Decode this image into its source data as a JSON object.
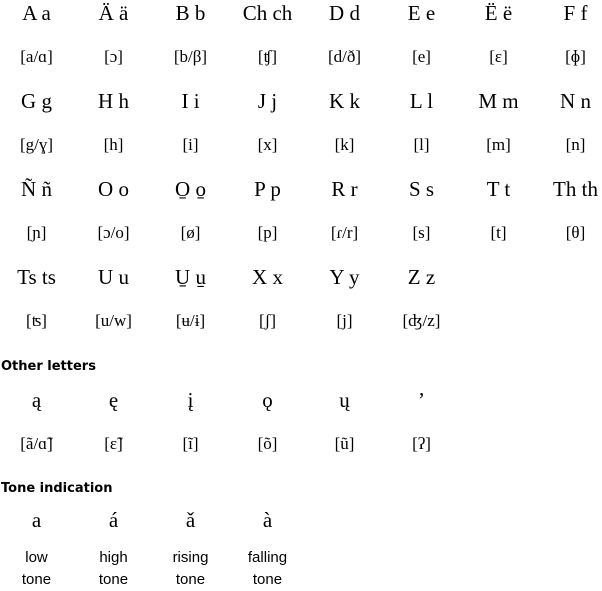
{
  "alphabet": {
    "rows": [
      {
        "letters": [
          "A a",
          "Ä ä",
          "B b",
          "Ch ch",
          "D d",
          "E e",
          "Ë ë",
          "F f"
        ],
        "ipa": [
          "[a/ɑ]",
          "[ɔ]",
          "[b/β]",
          "[ʧ]",
          "[d/ð]",
          "[e]",
          "[ɛ]",
          "[ɸ]"
        ]
      },
      {
        "letters": [
          "G g",
          "H h",
          "I i",
          "J j",
          "K k",
          "L l",
          "M m",
          "N n"
        ],
        "ipa": [
          "[g/ɣ]",
          "[h]",
          "[i]",
          "[x]",
          "[k]",
          "[l]",
          "[m]",
          "[n]"
        ]
      },
      {
        "letters": [
          "Ñ ñ",
          "O o",
          "O̱ o̱",
          "P p",
          "R r",
          "S s",
          "T t",
          "Th th"
        ],
        "ipa": [
          "[ɲ]",
          "[ɔ/o]",
          "[ø]",
          "[p]",
          "[ɾ/r]",
          "[s]",
          "[t]",
          "[θ]"
        ]
      },
      {
        "letters": [
          "Ts ts",
          "U u",
          "U̱ u̱",
          "X x",
          "Y y",
          "Z z"
        ],
        "ipa": [
          "[ʦ]",
          "[u/w]",
          "[ʉ/ɨ]",
          "[ʃ]",
          "[j]",
          "[ʤ/z]"
        ]
      }
    ]
  },
  "other_letters": {
    "heading": "Other letters",
    "letters": [
      "ą",
      "ę",
      "į",
      "ǫ",
      "ų",
      "’"
    ],
    "ipa": [
      "[ã/ɑ̃]",
      "[ɛ̃]",
      "[ĩ]",
      "[õ]",
      "[ũ]",
      "[ʔ]"
    ]
  },
  "tone_indication": {
    "heading": "Tone indication",
    "symbols": [
      "a",
      "á",
      "ǎ",
      "à"
    ],
    "labels": [
      [
        "low",
        "tone"
      ],
      [
        "high",
        "tone"
      ],
      [
        "rising",
        "tone"
      ],
      [
        "falling",
        "tone"
      ]
    ]
  }
}
